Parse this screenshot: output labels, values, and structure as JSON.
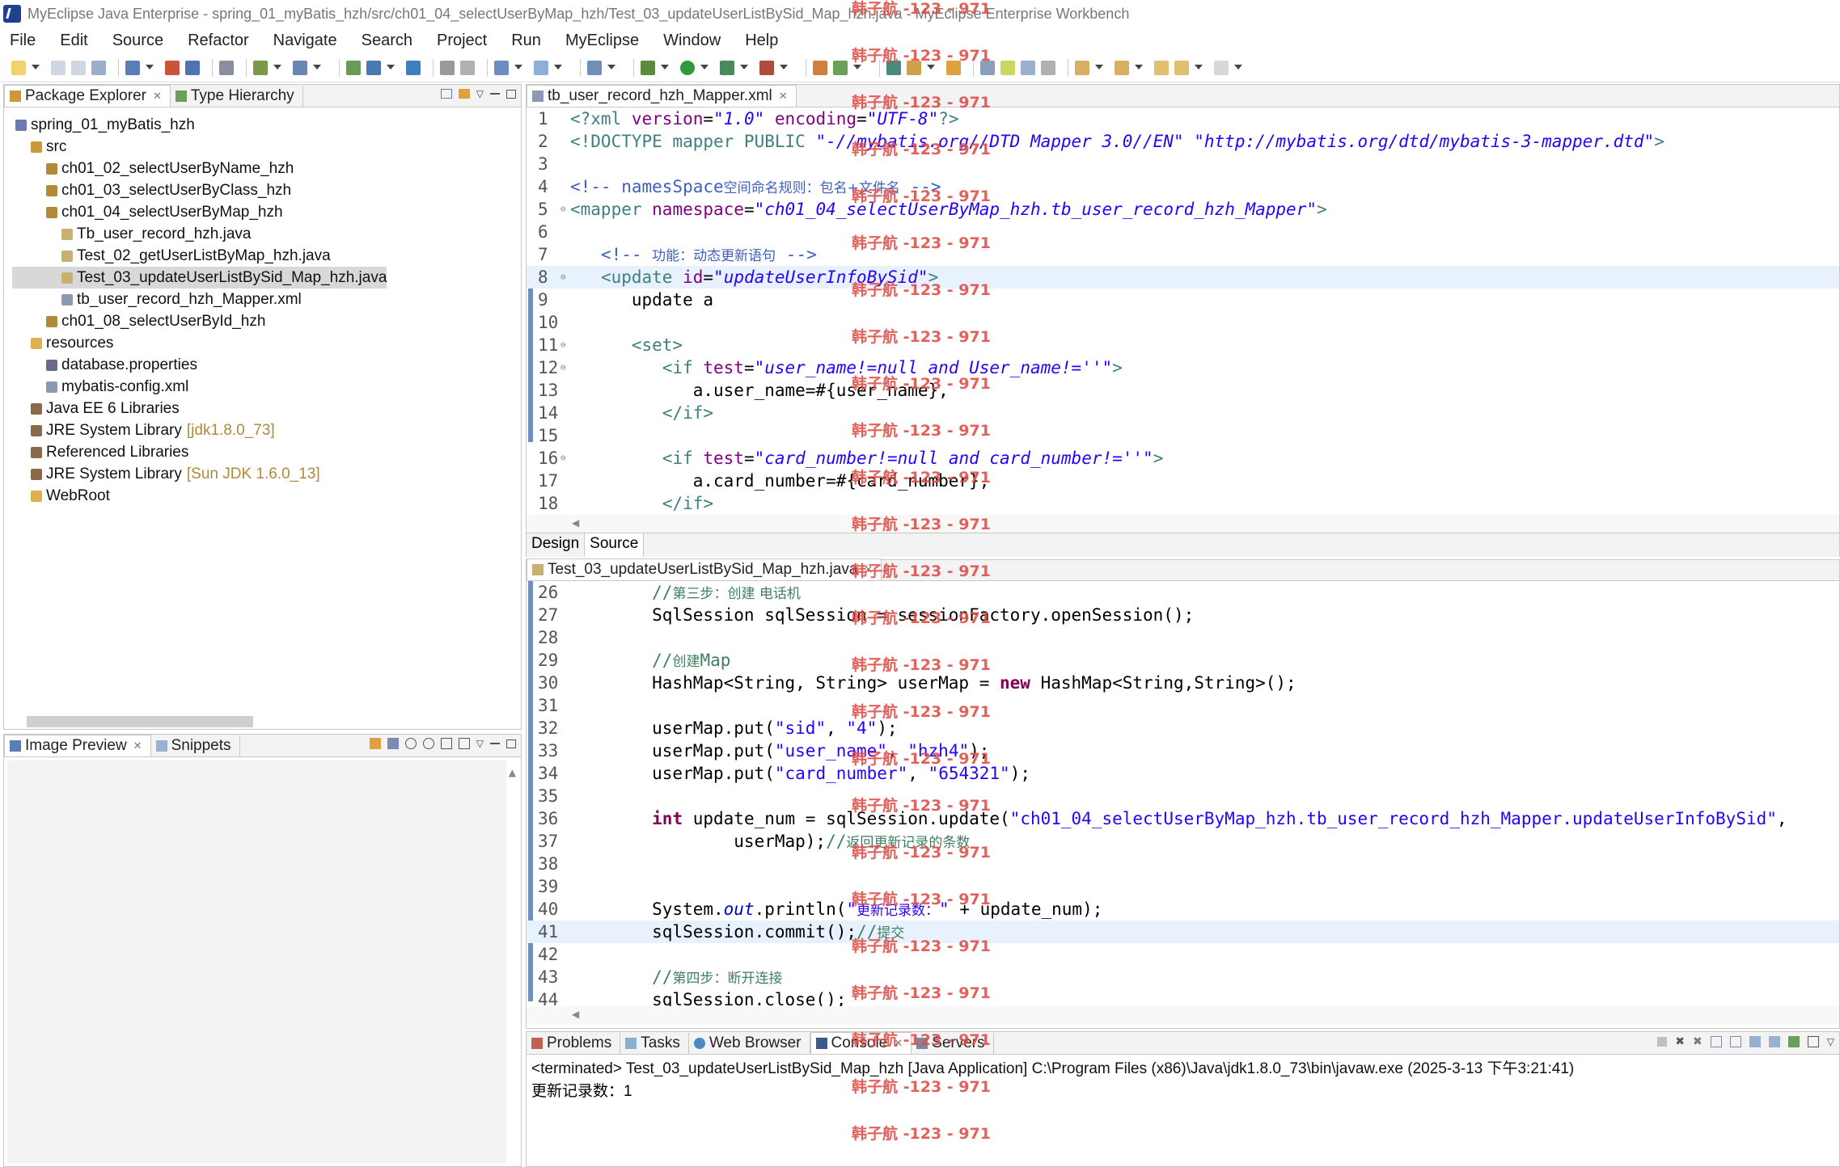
{
  "window": {
    "title": "MyEclipse Java Enterprise - spring_01_myBatis_hzh/src/ch01_04_selectUserByMap_hzh/Test_03_updateUserListBySid_Map_hzh.java - MyEclipse Enterprise Workbench"
  },
  "menu": [
    "File",
    "Edit",
    "Source",
    "Refactor",
    "Navigate",
    "Search",
    "Project",
    "Run",
    "MyEclipse",
    "Window",
    "Help"
  ],
  "explorer": {
    "tabs": [
      "Package Explorer",
      "Type Hierarchy"
    ],
    "tree": [
      {
        "label": "spring_01_myBatis_hzh",
        "decoration": "",
        "icon": "project-icon"
      },
      {
        "label": "src",
        "decoration": "",
        "icon": "source-folder-icon"
      },
      {
        "label": "ch01_02_selectUserByName_hzh",
        "decoration": "",
        "icon": "package-icon"
      },
      {
        "label": "ch01_03_selectUserByClass_hzh",
        "decoration": "",
        "icon": "package-icon"
      },
      {
        "label": "ch01_04_selectUserByMap_hzh",
        "decoration": "",
        "icon": "package-icon"
      },
      {
        "label": "Tb_user_record_hzh.java",
        "decoration": "",
        "icon": "java-file-icon"
      },
      {
        "label": "Test_02_getUserListByMap_hzh.java",
        "decoration": "",
        "icon": "java-file-icon"
      },
      {
        "label": "Test_03_updateUserListBySid_Map_hzh.java",
        "decoration": "",
        "icon": "java-file-icon"
      },
      {
        "label": "tb_user_record_hzh_Mapper.xml",
        "decoration": "",
        "icon": "xml-file-icon"
      },
      {
        "label": "ch01_08_selectUserById_hzh",
        "decoration": "",
        "icon": "package-icon"
      },
      {
        "label": "resources",
        "decoration": "",
        "icon": "folder-icon"
      },
      {
        "label": "database.properties",
        "decoration": "",
        "icon": "properties-file-icon"
      },
      {
        "label": "mybatis-config.xml",
        "decoration": "",
        "icon": "xml-file-icon"
      },
      {
        "label": "Java EE 6 Libraries",
        "decoration": "",
        "icon": "library-icon"
      },
      {
        "label": "JRE System Library",
        "decoration": "[jdk1.8.0_73]",
        "icon": "library-icon"
      },
      {
        "label": "Referenced Libraries",
        "decoration": "",
        "icon": "library-icon"
      },
      {
        "label": "JRE System Library",
        "decoration": "[Sun JDK 1.6.0_13]",
        "icon": "library-icon"
      },
      {
        "label": "WebRoot",
        "decoration": "",
        "icon": "folder-icon"
      }
    ]
  },
  "preview": {
    "tabs": [
      "Image Preview",
      "Snippets"
    ]
  },
  "xml_editor": {
    "tab": "tb_user_record_hzh_Mapper.xml",
    "bottom_tabs": [
      "Design",
      "Source"
    ]
  },
  "java_editor": {
    "tab": "Test_03_updateUserListBySid_Map_hzh.java"
  },
  "console": {
    "tabs": [
      "Problems",
      "Tasks",
      "Web Browser",
      "Console",
      "Servers"
    ],
    "terminated": "<terminated> Test_03_updateUserListBySid_Map_hzh [Java Application] C:\\Program Files (x86)\\Java\\jdk1.8.0_73\\bin\\javaw.exe (2025-3-13 下午3:21:41)",
    "output": "更新记录数：1"
  },
  "watermark": "韩子航 -123 - 971",
  "colors": {
    "accent": "#6b8fc9",
    "watermark": "#e0504a",
    "current_line": "#e8f2fe"
  }
}
